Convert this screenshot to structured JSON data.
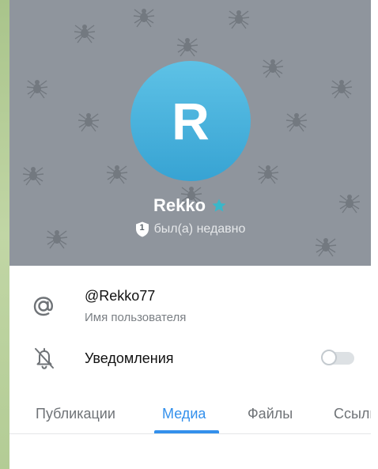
{
  "profile": {
    "avatar_letter": "R",
    "name": "Rekko",
    "status_badge": "1",
    "status": "был(а) недавно"
  },
  "username_row": {
    "value": "@Rekko77",
    "label": "Имя пользователя"
  },
  "notifications_row": {
    "label": "Уведомления",
    "enabled": false
  },
  "tabs": [
    {
      "label": "Публикации",
      "active": false
    },
    {
      "label": "Медиа",
      "active": true
    },
    {
      "label": "Файлы",
      "active": false
    },
    {
      "label": "Ссылки",
      "active": false
    }
  ],
  "colors": {
    "accent": "#3390ec",
    "header_bg": "#8f959d",
    "avatar_top": "#5ec2e6",
    "avatar_bottom": "#37a3d3",
    "star": "#3ab7c9"
  },
  "icons": {
    "username": "at-sign-icon",
    "notifications": "bell-off-icon",
    "premium": "star-icon",
    "status_badge": "shield-badge-icon"
  }
}
